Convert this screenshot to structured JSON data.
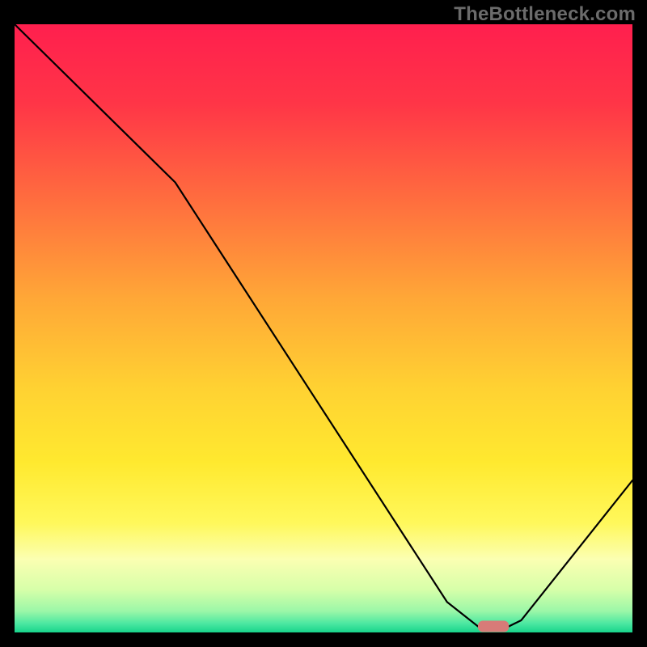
{
  "watermark": "TheBottleneck.com",
  "chart_data": {
    "type": "line",
    "title": "",
    "xlabel": "",
    "ylabel": "",
    "xlim": [
      0,
      100
    ],
    "ylim": [
      0,
      100
    ],
    "grid": false,
    "legend": false,
    "series": [
      {
        "name": "curve",
        "x": [
          0,
          22,
          26,
          70,
          75,
          80,
          82,
          100
        ],
        "values": [
          100,
          78,
          74,
          5,
          1,
          1,
          2,
          25
        ]
      }
    ],
    "marker": {
      "name": "minimum-marker",
      "x_start": 75,
      "x_end": 80,
      "y": 1,
      "color": "#d87b78"
    },
    "gradient_stops": [
      {
        "offset": 0.0,
        "color": "#ff1f4e"
      },
      {
        "offset": 0.13,
        "color": "#ff3547"
      },
      {
        "offset": 0.28,
        "color": "#ff6a3f"
      },
      {
        "offset": 0.45,
        "color": "#ffa737"
      },
      {
        "offset": 0.6,
        "color": "#ffd232"
      },
      {
        "offset": 0.72,
        "color": "#ffe92f"
      },
      {
        "offset": 0.82,
        "color": "#fff85b"
      },
      {
        "offset": 0.88,
        "color": "#fbffb2"
      },
      {
        "offset": 0.93,
        "color": "#d6ffa9"
      },
      {
        "offset": 0.965,
        "color": "#9bf7a8"
      },
      {
        "offset": 0.985,
        "color": "#4de8a1"
      },
      {
        "offset": 1.0,
        "color": "#18d48c"
      }
    ]
  }
}
